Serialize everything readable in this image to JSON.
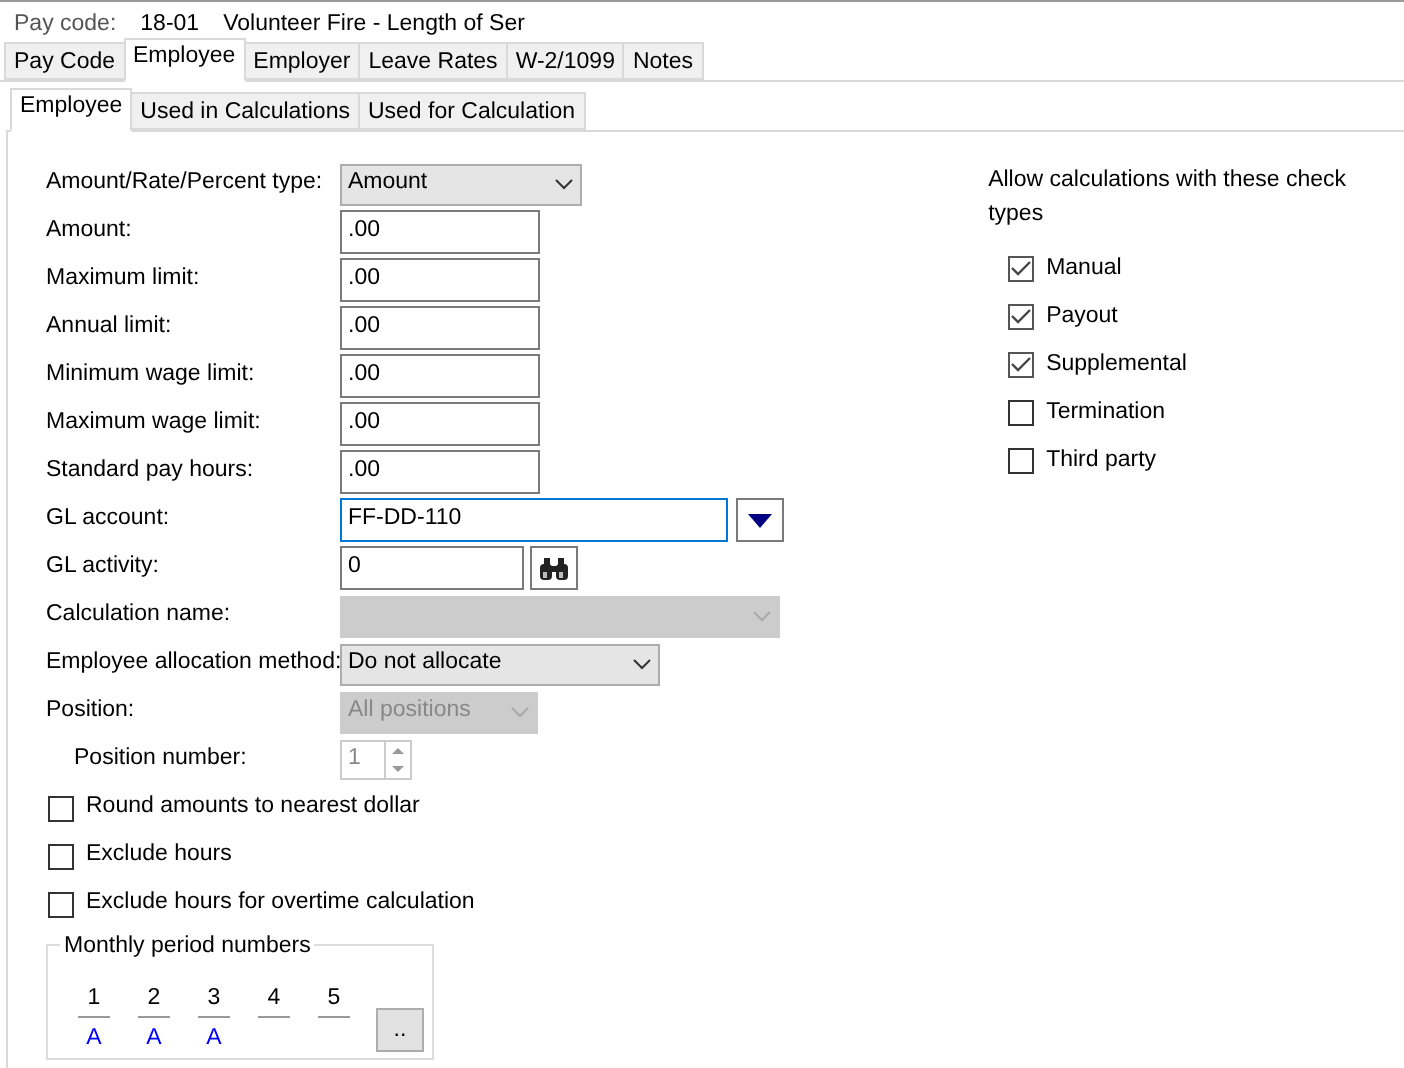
{
  "header": {
    "label": "Pay code:",
    "code": "18-01",
    "description": "Volunteer Fire - Length of Ser"
  },
  "tabs": [
    {
      "label": "Pay Code",
      "selected": false
    },
    {
      "label": "Employee",
      "selected": true
    },
    {
      "label": "Employer",
      "selected": false
    },
    {
      "label": "Leave Rates",
      "selected": false
    },
    {
      "label": "W-2/1099",
      "selected": false
    },
    {
      "label": "Notes",
      "selected": false
    }
  ],
  "subtabs": [
    {
      "label": "Employee",
      "selected": true
    },
    {
      "label": "Used in Calculations",
      "selected": false
    },
    {
      "label": "Used for Calculation",
      "selected": false
    }
  ],
  "fields": [
    {
      "kind": "select",
      "label": "Amount/Rate/Percent type:",
      "value": "Amount",
      "disabled": false
    },
    {
      "kind": "text",
      "label": "Amount:",
      "value": ".00",
      "disabled": false
    },
    {
      "kind": "text",
      "label": "Maximum limit:",
      "value": ".00",
      "disabled": false
    },
    {
      "kind": "text",
      "label": "Annual limit:",
      "value": ".00",
      "disabled": false
    },
    {
      "kind": "text",
      "label": "Minimum wage limit:",
      "value": ".00",
      "disabled": false
    },
    {
      "kind": "text",
      "label": "Maximum wage limit:",
      "value": ".00",
      "disabled": false
    },
    {
      "kind": "text",
      "label": "Standard pay hours:",
      "value": ".00",
      "disabled": false
    },
    {
      "kind": "lookup",
      "label": "GL account:",
      "value": "FF-DD-110",
      "disabled": false,
      "focused": true
    },
    {
      "kind": "search",
      "label": "GL activity:",
      "value": "0",
      "disabled": false
    },
    {
      "kind": "select",
      "label": "Calculation name:",
      "disabled": true
    },
    {
      "kind": "select",
      "label": "Employee allocation method:",
      "value": "Do not allocate",
      "disabled": false
    },
    {
      "kind": "select",
      "label": "Position:",
      "value": "All positions",
      "disabled": true
    },
    {
      "kind": "spinner",
      "label": "Position number:",
      "value": "1",
      "disabled": true
    }
  ],
  "options": [
    {
      "label": "Round amounts to nearest dollar",
      "checked": false
    },
    {
      "label": "Exclude hours",
      "checked": false
    },
    {
      "label": "Exclude hours for overtime calculation",
      "checked": false
    }
  ],
  "periods": {
    "title": "Monthly period numbers",
    "items": [
      {
        "number": "1",
        "value": "A"
      },
      {
        "number": "2",
        "value": "A"
      },
      {
        "number": "3",
        "value": "A"
      },
      {
        "number": "4"
      },
      {
        "number": "5"
      }
    ],
    "button": ".."
  },
  "check_types": {
    "title": "Allow calculations with these check types",
    "items": [
      {
        "label": "Manual",
        "checked": true
      },
      {
        "label": "Payout",
        "checked": true
      },
      {
        "label": "Supplemental",
        "checked": true
      },
      {
        "label": "Termination",
        "checked": false
      },
      {
        "label": "Third party",
        "checked": false
      }
    ]
  }
}
